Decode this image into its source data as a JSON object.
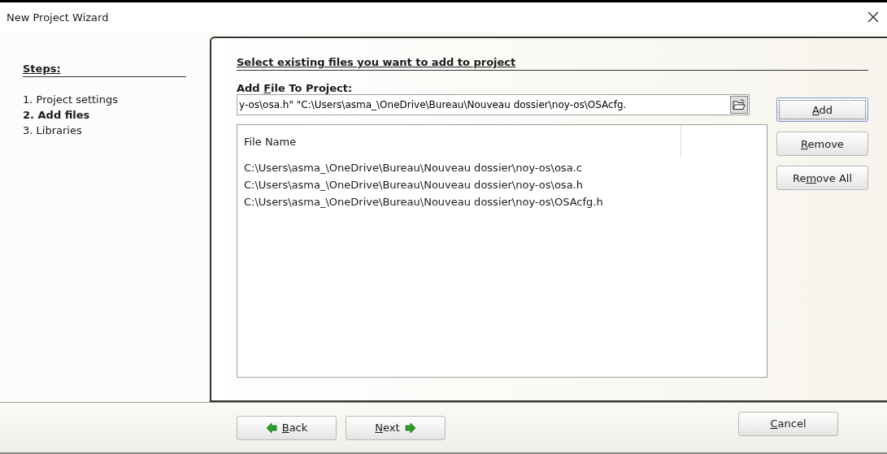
{
  "window": {
    "title": "New Project Wizard"
  },
  "steps": {
    "title": "Steps:",
    "items": [
      {
        "label": "1. Project settings",
        "selected": false
      },
      {
        "label": "2. Add files",
        "selected": true
      },
      {
        "label": "3. Libraries",
        "selected": false
      }
    ]
  },
  "panel": {
    "heading": "Select existing files you want to add to project",
    "field_label": {
      "before": "Add ",
      "key": "F",
      "after": "ile To Project:"
    },
    "field_value": "y-os\\osa.h\" \"C:\\Users\\asma_\\OneDrive\\Bureau\\Nouveau dossier\\noy-os\\OSAcfg.",
    "list": {
      "columns": [
        "File Name"
      ],
      "rows": [
        "C:\\Users\\asma_\\OneDrive\\Bureau\\Nouveau dossier\\noy-os\\osa.c",
        "C:\\Users\\asma_\\OneDrive\\Bureau\\Nouveau dossier\\noy-os\\osa.h",
        "C:\\Users\\asma_\\OneDrive\\Bureau\\Nouveau dossier\\noy-os\\OSAcfg.h"
      ]
    },
    "side_buttons": [
      {
        "key": "A",
        "after": "dd",
        "focused": true
      },
      {
        "key": "R",
        "after": "emove",
        "focused": false
      },
      {
        "before": "Re",
        "key": "m",
        "after": "ove All",
        "focused": false
      }
    ]
  },
  "footer": {
    "back": {
      "key": "B",
      "after": "ack"
    },
    "next": {
      "key": "N",
      "after": "ext"
    },
    "cancel": {
      "key": "C",
      "after": "ancel"
    }
  }
}
